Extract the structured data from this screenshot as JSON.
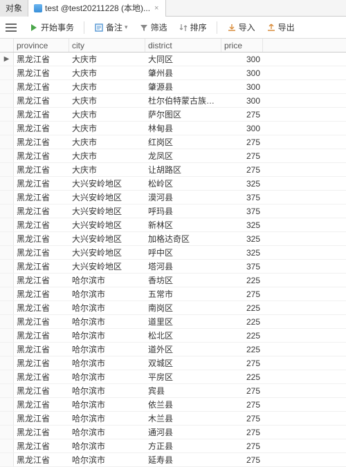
{
  "tabs": [
    {
      "label": "对象"
    },
    {
      "label": "test @test20211228 (本地)..."
    }
  ],
  "toolbar": {
    "begin_tx": "开始事务",
    "memo": "备注",
    "filter": "筛选",
    "sort": "排序",
    "import": "导入",
    "export": "导出"
  },
  "columns": {
    "province": "province",
    "city": "city",
    "district": "district",
    "price": "price"
  },
  "rows": [
    {
      "province": "黑龙江省",
      "city": "大庆市",
      "district": "大同区",
      "price": "300"
    },
    {
      "province": "黑龙江省",
      "city": "大庆市",
      "district": "肇州县",
      "price": "300"
    },
    {
      "province": "黑龙江省",
      "city": "大庆市",
      "district": "肇源县",
      "price": "300"
    },
    {
      "province": "黑龙江省",
      "city": "大庆市",
      "district": "杜尔伯特蒙古族自治县",
      "price": "300"
    },
    {
      "province": "黑龙江省",
      "city": "大庆市",
      "district": "萨尔图区",
      "price": "275"
    },
    {
      "province": "黑龙江省",
      "city": "大庆市",
      "district": "林甸县",
      "price": "300"
    },
    {
      "province": "黑龙江省",
      "city": "大庆市",
      "district": "红岗区",
      "price": "275"
    },
    {
      "province": "黑龙江省",
      "city": "大庆市",
      "district": "龙凤区",
      "price": "275"
    },
    {
      "province": "黑龙江省",
      "city": "大庆市",
      "district": "让胡路区",
      "price": "275"
    },
    {
      "province": "黑龙江省",
      "city": "大兴安岭地区",
      "district": "松岭区",
      "price": "325"
    },
    {
      "province": "黑龙江省",
      "city": "大兴安岭地区",
      "district": "漠河县",
      "price": "375"
    },
    {
      "province": "黑龙江省",
      "city": "大兴安岭地区",
      "district": "呼玛县",
      "price": "375"
    },
    {
      "province": "黑龙江省",
      "city": "大兴安岭地区",
      "district": "新林区",
      "price": "325"
    },
    {
      "province": "黑龙江省",
      "city": "大兴安岭地区",
      "district": "加格达奇区",
      "price": "325"
    },
    {
      "province": "黑龙江省",
      "city": "大兴安岭地区",
      "district": "呼中区",
      "price": "325"
    },
    {
      "province": "黑龙江省",
      "city": "大兴安岭地区",
      "district": "塔河县",
      "price": "375"
    },
    {
      "province": "黑龙江省",
      "city": "哈尔滨市",
      "district": "香坊区",
      "price": "225"
    },
    {
      "province": "黑龙江省",
      "city": "哈尔滨市",
      "district": "五常市",
      "price": "275"
    },
    {
      "province": "黑龙江省",
      "city": "哈尔滨市",
      "district": "南岗区",
      "price": "225"
    },
    {
      "province": "黑龙江省",
      "city": "哈尔滨市",
      "district": "道里区",
      "price": "225"
    },
    {
      "province": "黑龙江省",
      "city": "哈尔滨市",
      "district": "松北区",
      "price": "225"
    },
    {
      "province": "黑龙江省",
      "city": "哈尔滨市",
      "district": "道外区",
      "price": "225"
    },
    {
      "province": "黑龙江省",
      "city": "哈尔滨市",
      "district": "双城区",
      "price": "275"
    },
    {
      "province": "黑龙江省",
      "city": "哈尔滨市",
      "district": "平房区",
      "price": "225"
    },
    {
      "province": "黑龙江省",
      "city": "哈尔滨市",
      "district": "宾县",
      "price": "275"
    },
    {
      "province": "黑龙江省",
      "city": "哈尔滨市",
      "district": "依兰县",
      "price": "275"
    },
    {
      "province": "黑龙江省",
      "city": "哈尔滨市",
      "district": "木兰县",
      "price": "275"
    },
    {
      "province": "黑龙江省",
      "city": "哈尔滨市",
      "district": "通河县",
      "price": "275"
    },
    {
      "province": "黑龙江省",
      "city": "哈尔滨市",
      "district": "方正县",
      "price": "275"
    },
    {
      "province": "黑龙江省",
      "city": "哈尔滨市",
      "district": "延寿县",
      "price": "275"
    }
  ]
}
